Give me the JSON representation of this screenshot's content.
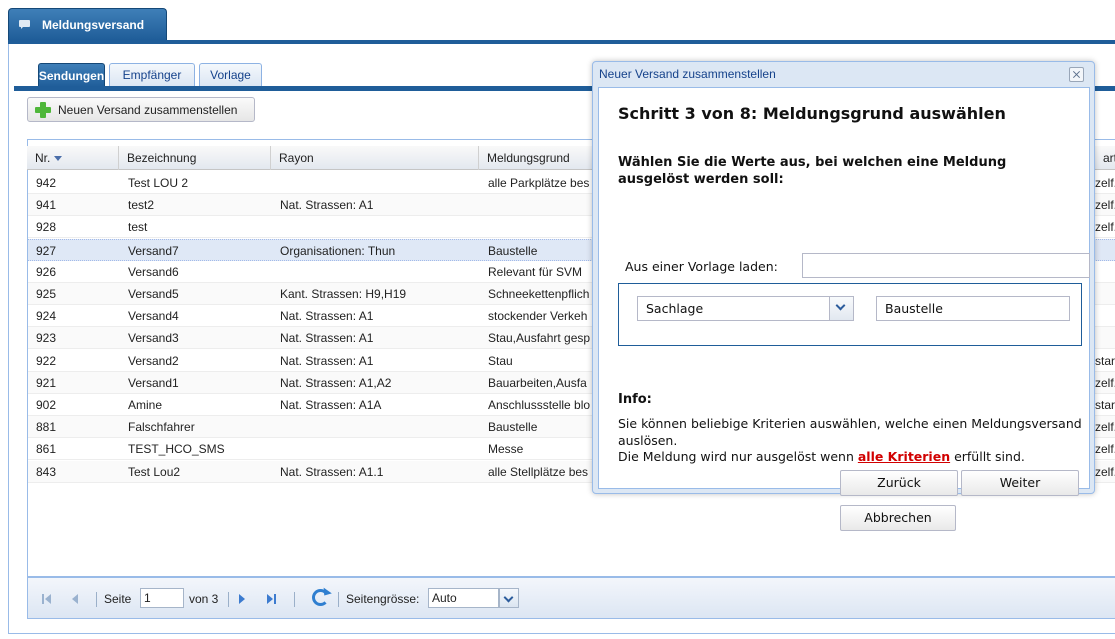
{
  "outer_tab": {
    "label": "Meldungsversand",
    "icon": "message-icon"
  },
  "tabs": [
    {
      "label": "Sendungen",
      "active": true
    },
    {
      "label": "Empfänger",
      "active": false
    },
    {
      "label": "Vorlage",
      "active": false
    }
  ],
  "toolbar": {
    "new_label": "Neuen Versand zusammenstellen",
    "new_icon": "plus-icon"
  },
  "grid": {
    "columns": [
      "Nr.",
      "Bezeichnung",
      "Rayon",
      "Meldungsgrund",
      "art"
    ],
    "rows": [
      {
        "nr": "942",
        "bez": "Test LOU 2",
        "rayon": "",
        "grund": "alle Parkplätze bes",
        "art": "zelf."
      },
      {
        "nr": "941",
        "bez": "test2",
        "rayon": "Nat. Strassen: A1",
        "grund": "",
        "art": "zelf."
      },
      {
        "nr": "928",
        "bez": "test",
        "rayon": "",
        "grund": "",
        "art": "zelf."
      },
      {
        "nr": "927",
        "bez": "Versand7",
        "rayon": "Organisationen: Thun",
        "grund": "Baustelle",
        "art": ""
      },
      {
        "nr": "926",
        "bez": "Versand6",
        "rayon": "",
        "grund": "Relevant für SVM",
        "art": ""
      },
      {
        "nr": "925",
        "bez": "Versand5",
        "rayon": "Kant. Strassen: H9,H19",
        "grund": "Schneekettenpflich",
        "art": ""
      },
      {
        "nr": "924",
        "bez": "Versand4",
        "rayon": "Nat. Strassen: A1",
        "grund": "stockender Verkeh",
        "art": ""
      },
      {
        "nr": "923",
        "bez": "Versand3",
        "rayon": "Nat. Strassen: A1",
        "grund": "Stau,Ausfahrt gesp",
        "art": ""
      },
      {
        "nr": "922",
        "bez": "Versand2",
        "rayon": "Nat. Strassen: A1",
        "grund": "Stau",
        "art": "star"
      },
      {
        "nr": "921",
        "bez": "Versand1",
        "rayon": "Nat. Strassen: A1,A2",
        "grund": "Bauarbeiten,Ausfa",
        "art": "zelf."
      },
      {
        "nr": "902",
        "bez": "Amine",
        "rayon": "Nat. Strassen: A1A",
        "grund": "Anschlussstelle blo",
        "art": "star"
      },
      {
        "nr": "881",
        "bez": "Falschfahrer",
        "rayon": "",
        "grund": "Baustelle",
        "art": "zelf."
      },
      {
        "nr": "861",
        "bez": "TEST_HCO_SMS",
        "rayon": "",
        "grund": "Messe",
        "art": "zelf."
      },
      {
        "nr": "843",
        "bez": "Test Lou2",
        "rayon": "Nat. Strassen: A1.1",
        "grund": "alle Stellplätze bes",
        "art": "zelf."
      }
    ]
  },
  "pager": {
    "page_label": "Seite",
    "page_value": "1",
    "of_label": "von 3",
    "size_label": "Seitengrösse:",
    "size_value": "Auto"
  },
  "dialog": {
    "title": "Neuer Versand zusammenstellen",
    "heading": "Schritt 3 von 8: Meldungsgrund auswählen",
    "subheading": "Wählen Sie die Werte aus, bei welchen eine Meldung ausgelöst werden soll:",
    "template_label": "Aus einer Vorlage laden:",
    "template_value": "",
    "criterion_type": "Sachlage",
    "criterion_value": "Baustelle",
    "info_heading": "Info:",
    "info_line1": "Sie können beliebige Kriterien auswählen, welche einen Meldungsversand auslösen.",
    "info_line2_pre": "Die Meldung wird nur ausgelöst wenn ",
    "info_line2_emph": "alle Kriterien",
    "info_line2_post": " erfüllt sind.",
    "back_label": "Zurück",
    "next_label": "Weiter",
    "cancel_label": "Abbrechen"
  },
  "colors": {
    "accent": "#1f5d99",
    "selected_row": "#dfe8f6",
    "emphasis_red": "#d10000",
    "add_green": "#4fb73a"
  }
}
